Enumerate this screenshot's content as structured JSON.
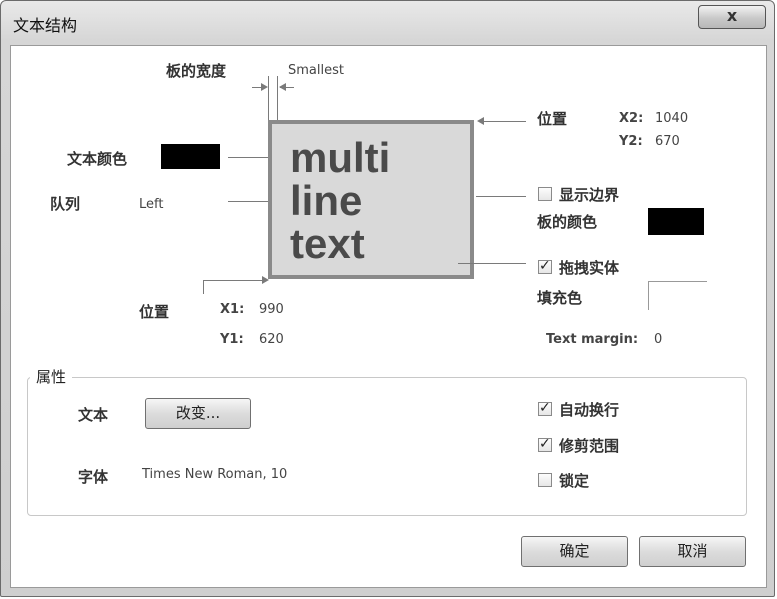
{
  "window": {
    "title": "文本结构",
    "close_label": "x"
  },
  "thickness": {
    "label": "板的宽度",
    "value": "Smallest"
  },
  "text_color": {
    "label": "文本颜色",
    "swatch": "#000000"
  },
  "alignment": {
    "label": "队列",
    "value": "Left"
  },
  "preview": {
    "text": "multi\nline\ntext"
  },
  "position_top": {
    "label": "位置",
    "x2_label": "X2:",
    "x2_value": "1040",
    "y2_label": "Y2:",
    "y2_value": "670"
  },
  "border": {
    "show_label": "显示边界",
    "show_checked": false,
    "color_label": "板的颜色",
    "color_swatch": "#000000"
  },
  "drag": {
    "label": "拖拽实体",
    "checked": true
  },
  "fill": {
    "label": "填充色"
  },
  "position_bottom": {
    "label": "位置",
    "x1_label": "X1:",
    "x1_value": "990",
    "y1_label": "Y1:",
    "y1_value": "620"
  },
  "text_margin": {
    "label": "Text margin:",
    "value": "0"
  },
  "properties": {
    "title": "属性",
    "text_label": "文本",
    "change_button": "改变...",
    "font_label": "字体",
    "font_value": "Times New Roman, 10",
    "word_wrap_label": "自动换行",
    "word_wrap_checked": true,
    "clip_label": "修剪范围",
    "clip_checked": true,
    "lock_label": "锁定",
    "lock_checked": false
  },
  "footer": {
    "ok_label": "确定",
    "cancel_label": "取消"
  }
}
